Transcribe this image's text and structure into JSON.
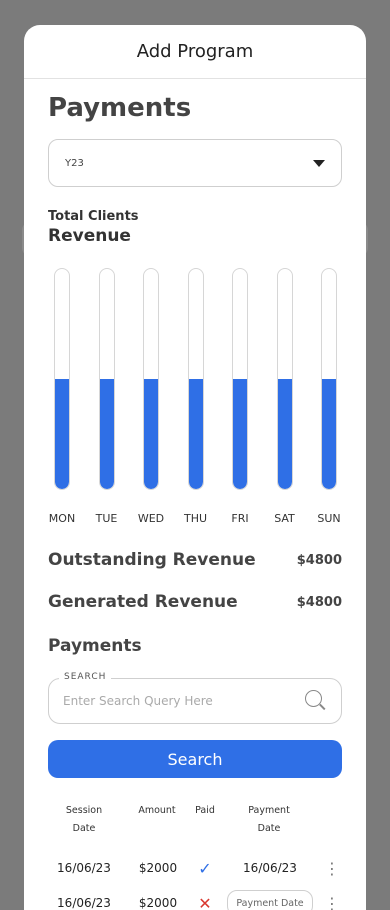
{
  "sheet": {
    "title": "Add Program"
  },
  "page": {
    "heading": "Payments"
  },
  "filter": {
    "selected": "Y23"
  },
  "revenue_chart": {
    "label_small": "Total Clients",
    "label_large": "Revenue"
  },
  "chart_data": {
    "type": "bar",
    "categories": [
      "MON",
      "TUE",
      "WED",
      "THU",
      "FRI",
      "SAT",
      "SUN"
    ],
    "values": [
      0.5,
      0.5,
      0.5,
      0.5,
      0.5,
      0.5,
      0.5
    ],
    "ylim": [
      0,
      1
    ],
    "grid": false,
    "colors": {
      "fill": "#2f6fe6",
      "track": "#ffffff"
    }
  },
  "summary": {
    "outstanding_label": "Outstanding Revenue",
    "outstanding_value": "$4800",
    "generated_label": "Generated Revenue",
    "generated_value": "$4800"
  },
  "payments_section": {
    "heading": "Payments",
    "search_label": "SEARCH",
    "search_placeholder": "Enter Search Query Here",
    "search_button": "Search"
  },
  "table": {
    "headers": {
      "session": "Session Date",
      "amount": "Amount",
      "paid": "Paid",
      "payment_date": "Payment Date"
    },
    "rows": [
      {
        "session_date": "16/06/23",
        "amount": "$2000",
        "paid": true,
        "payment_date": "16/06/23"
      },
      {
        "session_date": "16/06/23",
        "amount": "$2000",
        "paid": false,
        "payment_date_placeholder": "Payment Date"
      }
    ]
  },
  "colors": {
    "accent": "#2f6fe6",
    "error": "#d9382f"
  }
}
